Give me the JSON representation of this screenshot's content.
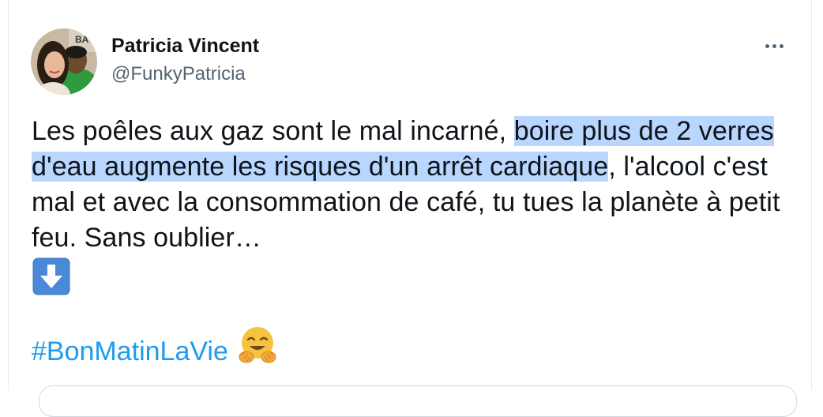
{
  "author": {
    "display_name": "Patricia Vincent",
    "handle": "@FunkyPatricia",
    "avatar_icon": "profile-photo"
  },
  "tweet": {
    "text_part1": "Les poêles aux gaz sont le mal incarné, ",
    "text_highlighted": "boire plus de 2 verres d'eau augmente les risques d'un arrêt cardiaque",
    "text_part2": ", l'alcool c'est mal et avec la consommation de café, tu tues la planète à petit feu. Sans oublier…",
    "down_arrow_emoji": "down-arrow-emoji",
    "hashtag": "#BonMatinLaVie",
    "hug_emoji": "hugging-face-emoji"
  },
  "colors": {
    "hashtag": "#1d9bf0",
    "highlight": "#b9d6ff",
    "secondary_text": "#536471",
    "emoji_button_blue": "#4a89d8"
  }
}
